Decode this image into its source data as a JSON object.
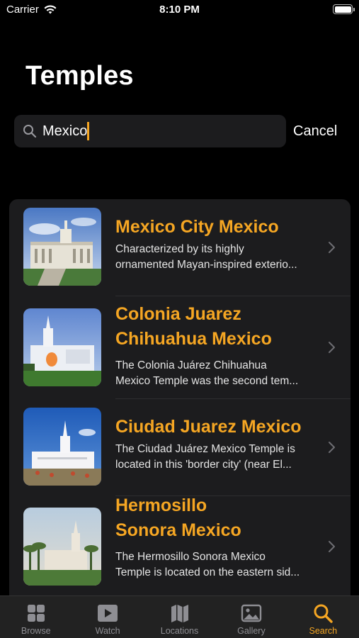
{
  "status_bar": {
    "carrier": "Carrier",
    "time": "8:10 PM",
    "battery_level": 1.0
  },
  "page": {
    "title": "Temples"
  },
  "search": {
    "value": "Mexico",
    "cancel_label": "Cancel"
  },
  "results": [
    {
      "title": "Mexico City Mexico",
      "description_line1": "Characterized by its highly",
      "description_line2": "ornamented Mayan-inspired exterio..."
    },
    {
      "title_line1": "Colonia Juarez",
      "title_line2": "Chihuahua Mexico",
      "description_line1": "The Colonia Juárez Chihuahua",
      "description_line2": "Mexico Temple was the second tem..."
    },
    {
      "title": "Ciudad Juarez Mexico",
      "description_line1": "The Ciudad Juárez Mexico Temple is",
      "description_line2": "located in this 'border city' (near El..."
    },
    {
      "title_line1": "Hermosillo",
      "title_line2": "Sonora Mexico",
      "description_line1": "The Hermosillo Sonora Mexico",
      "description_line2": "Temple is located on the eastern sid..."
    }
  ],
  "tab_bar": {
    "tabs": [
      {
        "label": "Browse",
        "icon": "grid-icon"
      },
      {
        "label": "Watch",
        "icon": "play-icon"
      },
      {
        "label": "Locations",
        "icon": "map-icon"
      },
      {
        "label": "Gallery",
        "icon": "photo-icon"
      },
      {
        "label": "Search",
        "icon": "search-icon"
      }
    ],
    "active": "Search"
  },
  "colors": {
    "accent": "#f5a623",
    "background": "#000000",
    "card": "#1c1c1e"
  }
}
